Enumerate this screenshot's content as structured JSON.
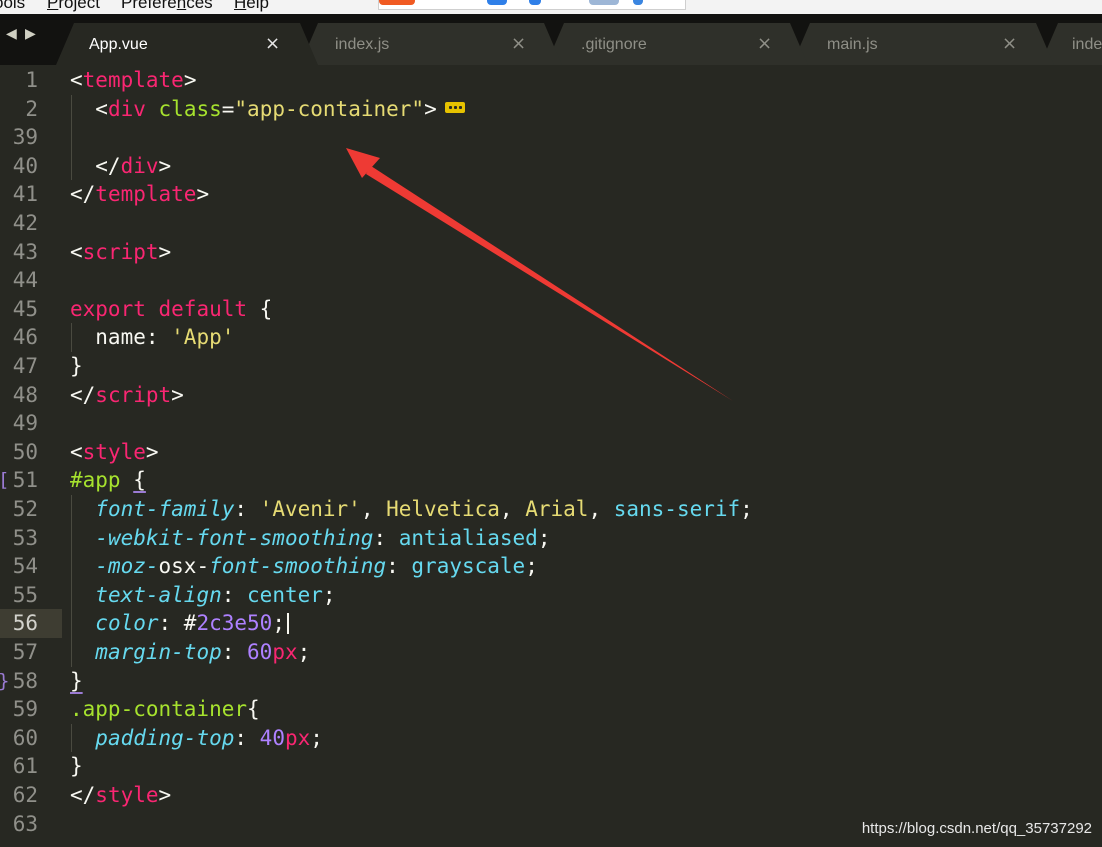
{
  "menu": {
    "items": [
      {
        "name": "menu-tools",
        "label": "ools",
        "ul": ""
      },
      {
        "name": "menu-project",
        "pre": "",
        "ul": "P",
        "post": "roject"
      },
      {
        "name": "menu-preferences",
        "pre": "Prefere",
        "ul": "n",
        "post": "ces"
      },
      {
        "name": "menu-help",
        "pre": "",
        "ul": "H",
        "post": "elp"
      }
    ]
  },
  "nav": {
    "back": "◀",
    "forward": "▶"
  },
  "tabs": [
    {
      "label": "App.vue",
      "close": "×",
      "active": true
    },
    {
      "label": "index.js",
      "close": "×",
      "active": false
    },
    {
      "label": ".gitignore",
      "close": "×",
      "active": false
    },
    {
      "label": "main.js",
      "close": "×",
      "active": false
    },
    {
      "label": "inde",
      "close": "",
      "active": false
    }
  ],
  "editor": {
    "current_line": "56",
    "lines": [
      {
        "num": "1",
        "tokens": [
          [
            "<",
            "plain"
          ],
          [
            "template",
            "tag"
          ],
          [
            ">",
            "plain"
          ]
        ]
      },
      {
        "num": "2",
        "indent": 1,
        "fold": true,
        "tokens": [
          [
            "  <",
            "plain"
          ],
          [
            "div",
            "tag"
          ],
          [
            " ",
            "plain"
          ],
          [
            "class",
            "attr"
          ],
          [
            "=",
            "plain"
          ],
          [
            "\"app-container\"",
            "str"
          ],
          [
            ">",
            "plain"
          ]
        ]
      },
      {
        "num": "39",
        "indent": 1,
        "tokens": []
      },
      {
        "num": "40",
        "indent": 1,
        "tokens": [
          [
            "  </",
            "plain"
          ],
          [
            "div",
            "tag"
          ],
          [
            ">",
            "plain"
          ]
        ]
      },
      {
        "num": "41",
        "tokens": [
          [
            "</",
            "plain"
          ],
          [
            "template",
            "tag"
          ],
          [
            ">",
            "plain"
          ]
        ]
      },
      {
        "num": "42",
        "tokens": []
      },
      {
        "num": "43",
        "tokens": [
          [
            "<",
            "plain"
          ],
          [
            "script",
            "tag"
          ],
          [
            ">",
            "plain"
          ]
        ]
      },
      {
        "num": "44",
        "tokens": []
      },
      {
        "num": "45",
        "tokens": [
          [
            "export",
            "key"
          ],
          [
            " ",
            "plain"
          ],
          [
            "default",
            "key"
          ],
          [
            " {",
            "plain"
          ]
        ]
      },
      {
        "num": "46",
        "indent": 1,
        "tokens": [
          [
            "  name: ",
            "plain"
          ],
          [
            "'App'",
            "str"
          ]
        ]
      },
      {
        "num": "47",
        "tokens": [
          [
            "}",
            "plain"
          ]
        ]
      },
      {
        "num": "48",
        "tokens": [
          [
            "</",
            "plain"
          ],
          [
            "script",
            "tag"
          ],
          [
            ">",
            "plain"
          ]
        ]
      },
      {
        "num": "49",
        "tokens": []
      },
      {
        "num": "50",
        "tokens": [
          [
            "<",
            "plain"
          ],
          [
            "style",
            "tag"
          ],
          [
            ">",
            "plain"
          ]
        ]
      },
      {
        "num": "51",
        "marker": "[",
        "tokens": [
          [
            "#app",
            "sel"
          ],
          [
            " ",
            "plain"
          ],
          [
            "{",
            "plain-ul"
          ]
        ]
      },
      {
        "num": "52",
        "indent": 1,
        "tokens": [
          [
            "  ",
            "plain"
          ],
          [
            "font-family",
            "prop"
          ],
          [
            ": ",
            "plain"
          ],
          [
            "'Avenir'",
            "str"
          ],
          [
            ", ",
            "plain"
          ],
          [
            "Helvetica",
            "str"
          ],
          [
            ", ",
            "plain"
          ],
          [
            "Arial",
            "str"
          ],
          [
            ", ",
            "plain"
          ],
          [
            "sans-serif",
            "val"
          ],
          [
            ";",
            "plain"
          ]
        ]
      },
      {
        "num": "53",
        "indent": 1,
        "tokens": [
          [
            "  ",
            "plain"
          ],
          [
            "-webkit-font-smoothing",
            "prop"
          ],
          [
            ": ",
            "plain"
          ],
          [
            "antialiased",
            "val"
          ],
          [
            ";",
            "plain"
          ]
        ]
      },
      {
        "num": "54",
        "indent": 1,
        "tokens": [
          [
            "  ",
            "plain"
          ],
          [
            "-moz-",
            "prop"
          ],
          [
            "osx-",
            "plain"
          ],
          [
            "font-smoothing",
            "prop"
          ],
          [
            ": ",
            "plain"
          ],
          [
            "grayscale",
            "val"
          ],
          [
            ";",
            "plain"
          ]
        ]
      },
      {
        "num": "55",
        "indent": 1,
        "tokens": [
          [
            "  ",
            "plain"
          ],
          [
            "text-align",
            "prop"
          ],
          [
            ": ",
            "plain"
          ],
          [
            "center",
            "val"
          ],
          [
            ";",
            "plain"
          ]
        ]
      },
      {
        "num": "56",
        "indent": 1,
        "caret": true,
        "tokens": [
          [
            "  ",
            "plain"
          ],
          [
            "color",
            "prop"
          ],
          [
            ": #",
            "plain"
          ],
          [
            "2c3e50",
            "num"
          ],
          [
            ";",
            "plain"
          ]
        ]
      },
      {
        "num": "57",
        "indent": 1,
        "tokens": [
          [
            "  ",
            "plain"
          ],
          [
            "margin-top",
            "prop"
          ],
          [
            ": ",
            "plain"
          ],
          [
            "60",
            "num"
          ],
          [
            "px",
            "key"
          ],
          [
            ";",
            "plain"
          ]
        ]
      },
      {
        "num": "58",
        "marker": "}",
        "tokens": [
          [
            "}",
            "plain-ul"
          ]
        ]
      },
      {
        "num": "59",
        "tokens": [
          [
            ".app-container",
            "sel"
          ],
          [
            "{",
            "plain"
          ]
        ]
      },
      {
        "num": "60",
        "indent": 1,
        "tokens": [
          [
            "  ",
            "plain"
          ],
          [
            "padding-top",
            "prop"
          ],
          [
            ": ",
            "plain"
          ],
          [
            "40",
            "num"
          ],
          [
            "px",
            "key"
          ],
          [
            ";",
            "plain"
          ]
        ]
      },
      {
        "num": "61",
        "tokens": [
          [
            "}",
            "plain"
          ]
        ]
      },
      {
        "num": "62",
        "tokens": [
          [
            "</",
            "plain"
          ],
          [
            "style",
            "tag"
          ],
          [
            ">",
            "plain"
          ]
        ]
      },
      {
        "num": "63",
        "tokens": []
      }
    ]
  },
  "colors": {
    "editor_bg": "#272822",
    "tab_bar_bg": "#121210",
    "active_tab_bg": "#272822",
    "inactive_tab_bg": "#2f302a",
    "annotation_arrow": "#ee3a34"
  },
  "watermark": "https://blog.csdn.net/qq_35737292"
}
